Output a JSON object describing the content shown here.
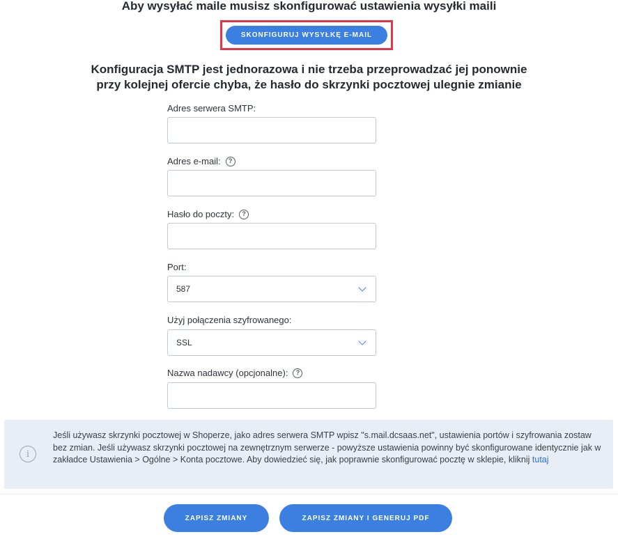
{
  "header": {
    "title": "Aby wysyłać maile musisz skonfigurować ustawienia wysyłki maili",
    "configure_button": "SKONFIGURUJ WYSYŁKĘ E-MAIL",
    "subtitle_line1": "Konfiguracja SMTP jest jednorazowa i nie trzeba przeprowadzać jej ponownie",
    "subtitle_line2": "przy kolejnej ofercie chyba, że hasło do skrzynki pocztowej ulegnie zmianie"
  },
  "form": {
    "smtp": {
      "label": "Adres serwera SMTP:",
      "value": ""
    },
    "email": {
      "label": "Adres e-mail:",
      "value": "",
      "help": "?"
    },
    "password": {
      "label": "Hasło do poczty:",
      "value": "",
      "help": "?"
    },
    "port": {
      "label": "Port:",
      "value": "587"
    },
    "encryption": {
      "label": "Użyj połączenia szyfrowanego:",
      "value": "SSL"
    },
    "sender": {
      "label": "Nazwa nadawcy (opcjonalne):",
      "value": "",
      "help": "?"
    }
  },
  "info": {
    "icon": "i",
    "text": "Jeśli używasz skrzynki pocztowej w Shoperze, jako adres serwera SMTP wpisz \"s.mail.dcsaas.net\", ustawienia portów i szyfrowania zostaw bez zmian. Jeśli używasz skrzynki pocztowej na zewnętrznym serwerze - powyższe ustawienia powinny być skonfigurowane identycznie jak w zakładce Ustawienia > Ogólne > Konta pocztowe. Aby dowiedzieć się, jak poprawnie skonfigurować pocztę w sklepie, kliknij",
    "link": "tutaj"
  },
  "footer": {
    "save_button": "ZAPISZ ZMIANY",
    "save_pdf_button": "ZAPISZ ZMIANY I GENERUJ PDF"
  },
  "colors": {
    "accent": "#3b7fe0",
    "highlight_border": "#e03645",
    "info_background": "#e9eef6"
  }
}
